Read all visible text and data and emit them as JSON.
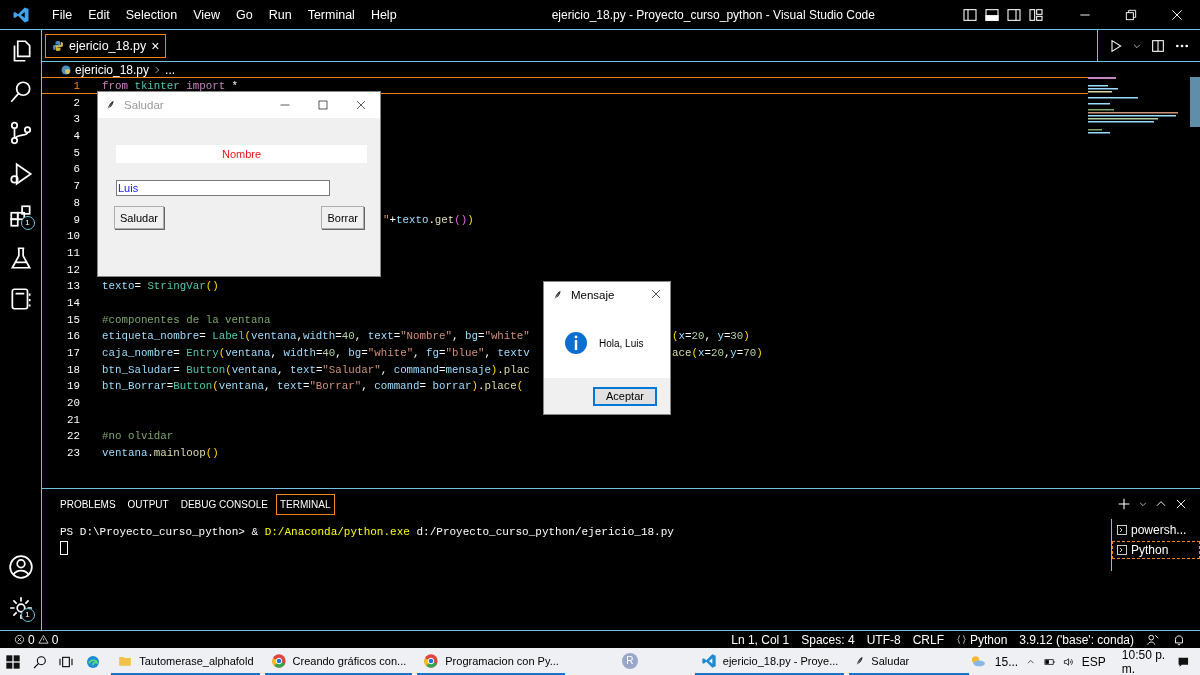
{
  "titlebar": {
    "menu": [
      "File",
      "Edit",
      "Selection",
      "View",
      "Go",
      "Run",
      "Terminal",
      "Help"
    ],
    "title": "ejericio_18.py - Proyecto_curso_python - Visual Studio Code"
  },
  "activity_bar": {
    "extensions_badge": "1",
    "settings_badge": "1"
  },
  "editor": {
    "tabs": [
      {
        "label": "ejericio_18.py",
        "close": "×",
        "selected": true
      }
    ],
    "breadcrumb": [
      "ejericio_18.py",
      "..."
    ],
    "lines": [
      {
        "number": "1",
        "current": true,
        "tokens": [
          {
            "text": "from",
            "kind": "kw"
          },
          {
            "text": " tkinter",
            "kind": "mod"
          },
          {
            "text": " import",
            "kind": "kw"
          },
          {
            "text": " *",
            "kind": "op"
          }
        ]
      },
      {
        "number": "2",
        "current": false
      },
      {
        "number": "3",
        "current": false
      },
      {
        "number": "4",
        "current": false
      },
      {
        "number": "5",
        "current": false
      },
      {
        "number": "6",
        "current": false
      },
      {
        "number": "7",
        "current": false
      },
      {
        "number": "8",
        "current": false
      },
      {
        "number": "9",
        "current": false,
        "tail": {
          "kind": "saludar",
          "tokens": [
            {
              "text": "\"",
              "kind": "str"
            },
            {
              "text": "+",
              "kind": "op"
            },
            {
              "text": "texto",
              "kind": "id"
            },
            {
              "text": ".",
              "kind": "op"
            },
            {
              "text": "get",
              "kind": "fn"
            },
            {
              "text": "()",
              "kind": "par2"
            },
            {
              "text": ")",
              "kind": "par"
            }
          ]
        }
      },
      {
        "number": "10",
        "current": false
      },
      {
        "number": "11",
        "current": false
      },
      {
        "number": "12",
        "current": false
      },
      {
        "number": "13",
        "current": false,
        "tokens": [
          {
            "text": "texto",
            "kind": "id"
          },
          {
            "text": "= ",
            "kind": "op"
          },
          {
            "text": "StringVar",
            "kind": "cls"
          },
          {
            "text": "()",
            "kind": "par"
          }
        ]
      },
      {
        "number": "14",
        "current": false
      },
      {
        "number": "15",
        "current": false,
        "tokens": [
          {
            "text": "#componentes de la ventana",
            "kind": "com"
          }
        ]
      },
      {
        "number": "16",
        "current": false,
        "tokens": [
          {
            "text": "etiqueta_nombre",
            "kind": "id"
          },
          {
            "text": "= ",
            "kind": "op"
          },
          {
            "text": "Label",
            "kind": "cls"
          },
          {
            "text": "(",
            "kind": "par"
          },
          {
            "text": "ventana",
            "kind": "id"
          },
          {
            "text": ",",
            "kind": "op"
          },
          {
            "text": "width",
            "kind": "id"
          },
          {
            "text": "=",
            "kind": "op"
          },
          {
            "text": "40",
            "kind": "num"
          },
          {
            "text": ", ",
            "kind": "op"
          },
          {
            "text": "text",
            "kind": "id"
          },
          {
            "text": "=",
            "kind": "op"
          },
          {
            "text": "\"Nombre\"",
            "kind": "str"
          },
          {
            "text": ", ",
            "kind": "op"
          },
          {
            "text": "bg",
            "kind": "id"
          },
          {
            "text": "=",
            "kind": "op"
          },
          {
            "text": "\"white\"",
            "kind": "str"
          }
        ],
        "tail": {
          "kind": "mensaje",
          "tokens": [
            {
              "text": "(",
              "kind": "par"
            },
            {
              "text": "x",
              "kind": "id"
            },
            {
              "text": "=",
              "kind": "op"
            },
            {
              "text": "20",
              "kind": "num"
            },
            {
              "text": ", ",
              "kind": "op"
            },
            {
              "text": "y",
              "kind": "id"
            },
            {
              "text": "=",
              "kind": "op"
            },
            {
              "text": "30",
              "kind": "num"
            },
            {
              "text": ")",
              "kind": "par"
            }
          ]
        }
      },
      {
        "number": "17",
        "current": false,
        "tokens": [
          {
            "text": "caja_nombre",
            "kind": "id"
          },
          {
            "text": "= ",
            "kind": "op"
          },
          {
            "text": "Entry",
            "kind": "cls"
          },
          {
            "text": "(",
            "kind": "par"
          },
          {
            "text": "ventana",
            "kind": "id"
          },
          {
            "text": ", ",
            "kind": "op"
          },
          {
            "text": "width",
            "kind": "id"
          },
          {
            "text": "=",
            "kind": "op"
          },
          {
            "text": "40",
            "kind": "num"
          },
          {
            "text": ", ",
            "kind": "op"
          },
          {
            "text": "bg",
            "kind": "id"
          },
          {
            "text": "=",
            "kind": "op"
          },
          {
            "text": "\"white\"",
            "kind": "str"
          },
          {
            "text": ", ",
            "kind": "op"
          },
          {
            "text": "fg",
            "kind": "id"
          },
          {
            "text": "=",
            "kind": "op"
          },
          {
            "text": "\"blue\"",
            "kind": "str"
          },
          {
            "text": ", ",
            "kind": "op"
          },
          {
            "text": "textv",
            "kind": "id"
          }
        ],
        "tail": {
          "kind": "mensaje",
          "tokens": [
            {
              "text": "ace",
              "kind": "fn"
            },
            {
              "text": "(",
              "kind": "par"
            },
            {
              "text": "x",
              "kind": "id"
            },
            {
              "text": "=",
              "kind": "op"
            },
            {
              "text": "20",
              "kind": "num"
            },
            {
              "text": ",",
              "kind": "op"
            },
            {
              "text": "y",
              "kind": "id"
            },
            {
              "text": "=",
              "kind": "op"
            },
            {
              "text": "70",
              "kind": "num"
            },
            {
              "text": ")",
              "kind": "par"
            }
          ]
        }
      },
      {
        "number": "18",
        "current": false,
        "tokens": [
          {
            "text": "btn_Saludar",
            "kind": "id"
          },
          {
            "text": "= ",
            "kind": "op"
          },
          {
            "text": "Button",
            "kind": "cls"
          },
          {
            "text": "(",
            "kind": "par"
          },
          {
            "text": "ventana",
            "kind": "id"
          },
          {
            "text": ", ",
            "kind": "op"
          },
          {
            "text": "text",
            "kind": "id"
          },
          {
            "text": "=",
            "kind": "op"
          },
          {
            "text": "\"Saludar\"",
            "kind": "str"
          },
          {
            "text": ", ",
            "kind": "op"
          },
          {
            "text": "command",
            "kind": "id"
          },
          {
            "text": "=",
            "kind": "op"
          },
          {
            "text": "mensaje",
            "kind": "id"
          },
          {
            "text": ")",
            "kind": "par"
          },
          {
            "text": ".",
            "kind": "op"
          },
          {
            "text": "plac",
            "kind": "fn"
          }
        ]
      },
      {
        "number": "19",
        "current": false,
        "tokens": [
          {
            "text": "btn_Borrar",
            "kind": "id"
          },
          {
            "text": "=",
            "kind": "op"
          },
          {
            "text": "Button",
            "kind": "cls"
          },
          {
            "text": "(",
            "kind": "par"
          },
          {
            "text": "ventana",
            "kind": "id"
          },
          {
            "text": ", ",
            "kind": "op"
          },
          {
            "text": "text",
            "kind": "id"
          },
          {
            "text": "=",
            "kind": "op"
          },
          {
            "text": "\"Borrar\"",
            "kind": "str"
          },
          {
            "text": ", ",
            "kind": "op"
          },
          {
            "text": "command",
            "kind": "id"
          },
          {
            "text": "= ",
            "kind": "op"
          },
          {
            "text": "borrar",
            "kind": "id"
          },
          {
            "text": ")",
            "kind": "par"
          },
          {
            "text": ".",
            "kind": "op"
          },
          {
            "text": "place",
            "kind": "fn"
          },
          {
            "text": "(",
            "kind": "par"
          }
        ]
      },
      {
        "number": "20",
        "current": false
      },
      {
        "number": "21",
        "current": false
      },
      {
        "number": "22",
        "current": false,
        "tokens": [
          {
            "text": "#no olvidar",
            "kind": "com"
          }
        ]
      },
      {
        "number": "23",
        "current": false,
        "tokens": [
          {
            "text": "ventana",
            "kind": "id"
          },
          {
            "text": ".",
            "kind": "op"
          },
          {
            "text": "mainloop",
            "kind": "fn"
          },
          {
            "text": "()",
            "kind": "par"
          }
        ]
      }
    ]
  },
  "saludar_window": {
    "title": "Saludar",
    "label": "Nombre",
    "entry_value": "Luis",
    "buttons": [
      "Saludar",
      "Borrar"
    ]
  },
  "message_dialog": {
    "title": "Mensaje",
    "message": "Hola, Luis",
    "button": "Aceptar"
  },
  "panel": {
    "tabs": [
      {
        "label": "PROBLEMS",
        "selected": false
      },
      {
        "label": "OUTPUT",
        "selected": false
      },
      {
        "label": "DEBUG CONSOLE",
        "selected": false
      },
      {
        "label": "TERMINAL",
        "selected": true
      }
    ],
    "terminal_line": [
      {
        "text": "PS D:\\Proyecto_curso_python> & ",
        "kind": "plain"
      },
      {
        "text": "D:/Anaconda/python.exe",
        "kind": "command"
      },
      {
        "text": " d:/Proyecto_curso_python/ejericio_18.py",
        "kind": "plain"
      }
    ],
    "terminals": [
      {
        "label": "powersh...",
        "selected": false
      },
      {
        "label": "Python",
        "selected": true
      }
    ]
  },
  "status_bar": {
    "errors": "0",
    "warnings": "0",
    "items": [
      {
        "text": "Ln 1, Col 1",
        "kind": "text"
      },
      {
        "text": "Spaces: 4",
        "kind": "text"
      },
      {
        "text": "UTF-8",
        "kind": "text"
      },
      {
        "text": "CRLF",
        "kind": "text"
      },
      {
        "text": "Python",
        "kind": "language"
      },
      {
        "text": "3.9.12 ('base': conda)",
        "kind": "text"
      }
    ]
  },
  "taskbar": {
    "apps": [
      {
        "label": "Tautomerase_alphafold",
        "kind": "folder"
      },
      {
        "label": "Creando gráficos con...",
        "kind": "browser"
      },
      {
        "label": "Programacion con Py...",
        "kind": "browser"
      },
      {
        "label": "R",
        "kind": "letter"
      },
      {
        "label": "ejericio_18.py - Proye...",
        "kind": "code"
      },
      {
        "label": "Saludar",
        "kind": "feather"
      }
    ],
    "weather": "15...",
    "language": "ESP",
    "time": "10:50 p. m."
  }
}
